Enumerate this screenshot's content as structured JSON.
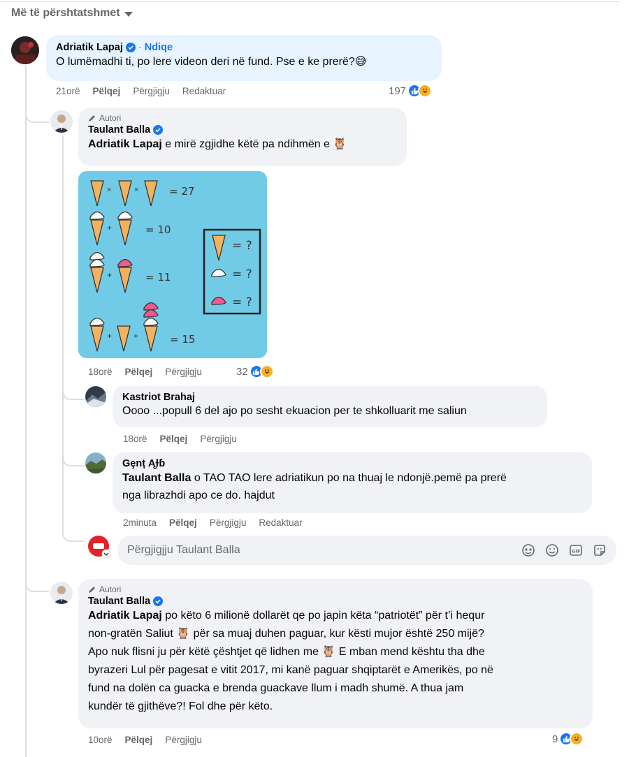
{
  "sort": {
    "label": "Më të përshtatshmet"
  },
  "comments": [
    {
      "author": "Adriatik Lapaj",
      "follow": "Ndiqe",
      "text": "O lumëmadhi ti, po lere videon deri në fund. Pse e ke prerë?",
      "emoji": "😅",
      "time": "21orë",
      "like": "Pëlqej",
      "reply": "Përgjigju",
      "edited": "Redaktuar",
      "reactions": "197"
    },
    {
      "author_tag": "Autori",
      "author": "Taulant Balla",
      "mention": "Adriatik Lapaj",
      "text": " e mirë zgjidhe këtë pa ndihmën e ",
      "emoji": "🦉",
      "time": "18orë",
      "like": "Pëlqej",
      "reply": "Përgjigju",
      "reactions": "32"
    },
    {
      "author": "Kastriot Brahaj",
      "text": "Oooo ...popull 6 del ajo po sesht ekuacion per te shkolluarit me saliun",
      "time": "18orë",
      "like": "Pëlqej",
      "reply": "Përgjigju"
    },
    {
      "author": "Gȩnț Ą̧ɫɓ",
      "mention": "Taulant Balla",
      "text_line1": " o TAO TAO lere adriatikun po na thuaj le ndonjë.pemë pa prerë",
      "text_line2": "nga librazhdi apo ce do. hajdut",
      "time": "2minuta",
      "like": "Pëlqej",
      "reply": "Përgjigju",
      "edited": "Redaktuar"
    },
    {
      "author_tag": "Autori",
      "author": "Taulant Balla",
      "mention": "Adriatik Lapaj",
      "lines": [
        " po këto 6 milionë dollarët qe po japin këta “patriotët” për t’i hequr",
        "non-gratën Saliut 🦉 për sa muaj duhen paguar, kur kësti mujor është 250 mijë?",
        "Apo nuk flisni ju për këtë çështjet që lidhen me 🦉 E mban mend kështu tha dhe",
        "byrazeri Lul për pagesat e vitit 2017, mi kanë paguar shqiptarët e Amerikës, po në",
        "fund na dolën ca guacka e brenda guackave llum i madh shumë. A thua jam",
        "kundër të gjithëve?! Fol dhe për këto."
      ],
      "time": "10orë",
      "like": "Pëlqej",
      "reply": "Përgjigju",
      "reactions": "9"
    }
  ],
  "reply_box": {
    "placeholder": "Përgjigjju Taulant Balla"
  },
  "puzzle": {
    "eq1": "= 27",
    "eq2": "= 10",
    "eq3": "= 11",
    "eq4": "= 15",
    "q": "= ?"
  },
  "colors": {
    "accent": "#1877f2",
    "bubble": "#f0f2f5",
    "highlight": "#e7f3ff",
    "puzzle_bg": "#72cbe6"
  }
}
